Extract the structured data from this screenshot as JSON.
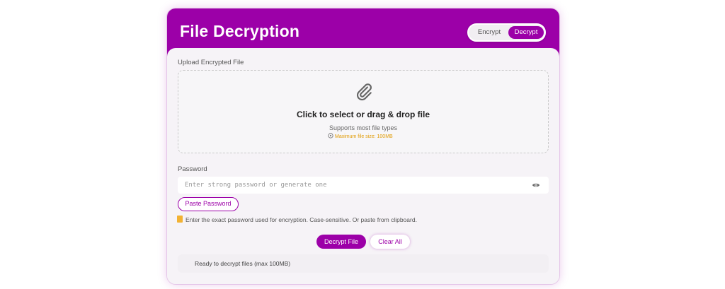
{
  "header": {
    "title": "File Decryption",
    "mode_encrypt": "Encrypt",
    "mode_decrypt": "Decrypt",
    "active_mode": "Decrypt"
  },
  "upload": {
    "label": "Upload Encrypted File",
    "icon": "paperclip-icon",
    "title": "Click to select or drag & drop file",
    "subtitle": "Supports most file types",
    "max_size": "Maximum file size: 100MB"
  },
  "password": {
    "label": "Password",
    "value": "",
    "placeholder": "Enter strong password or generate one",
    "paste_label": "Paste Password",
    "hint": "Enter the exact password used for encryption. Case-sensitive. Or paste from clipboard."
  },
  "actions": {
    "decrypt_label": "Decrypt File",
    "clear_label": "Clear All"
  },
  "status": {
    "text": "Ready to decrypt files (max 100MB)"
  },
  "colors": {
    "accent": "#9c00a8",
    "warning": "#e09a00"
  }
}
